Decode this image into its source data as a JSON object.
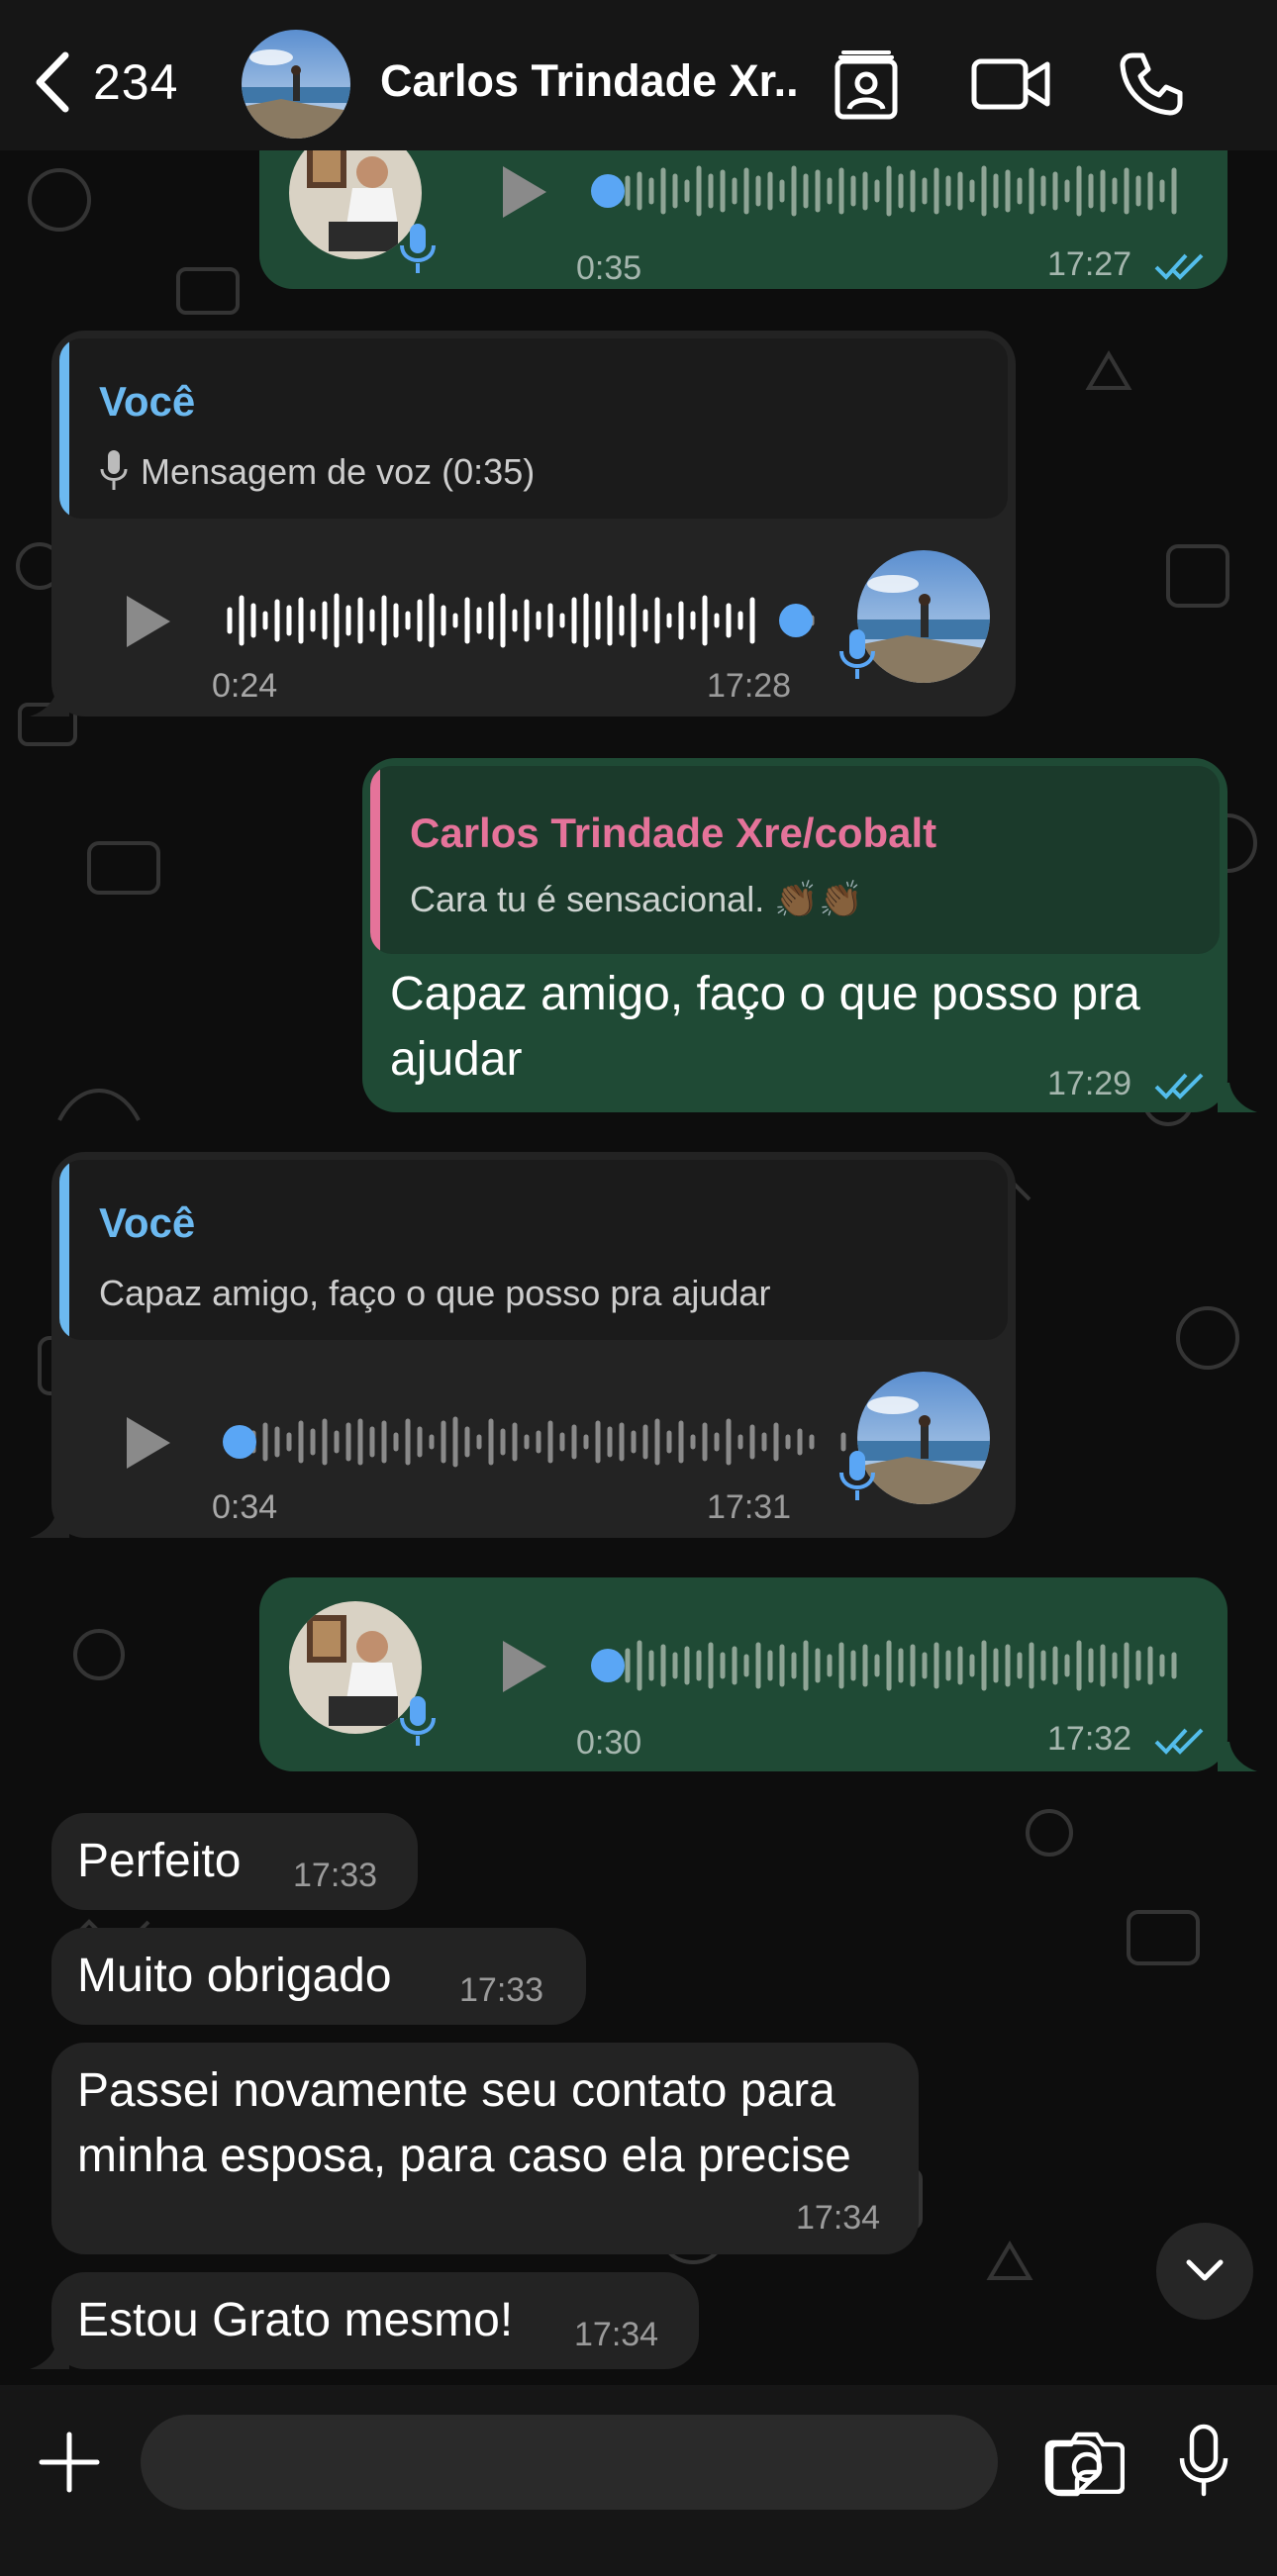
{
  "header": {
    "back_count": "234",
    "contact_name": "Carlos Trindade Xr..."
  },
  "messages": [
    {
      "id": "voice_out_1",
      "type": "voice",
      "direction": "out",
      "duration": "0:35",
      "time": "17:27",
      "status": "read"
    },
    {
      "id": "voice_in_1",
      "type": "voice",
      "direction": "in",
      "reply_to": {
        "sender": "Você",
        "text": "Mensagem de voz (0:35)"
      },
      "duration": "0:24",
      "time": "17:28",
      "progress": 0.93
    },
    {
      "id": "text_out_1",
      "type": "text",
      "direction": "out",
      "reply_to": {
        "sender": "Carlos Trindade Xre/cobalt",
        "text": "Cara tu é sensacional. 👏🏾👏🏾"
      },
      "text_line1": "Capaz amigo, faço o que posso pra",
      "text_line2": "ajudar",
      "time": "17:29",
      "status": "read"
    },
    {
      "id": "voice_in_2",
      "type": "voice",
      "direction": "in",
      "reply_to": {
        "sender": "Você",
        "text": "Capaz amigo, faço o que posso pra ajudar"
      },
      "duration": "0:34",
      "time": "17:31",
      "progress": 0.0
    },
    {
      "id": "voice_out_2",
      "type": "voice",
      "direction": "out",
      "duration": "0:30",
      "time": "17:32",
      "status": "read"
    },
    {
      "id": "text_in_1",
      "type": "text",
      "direction": "in",
      "text": "Perfeito",
      "time": "17:33"
    },
    {
      "id": "text_in_2",
      "type": "text",
      "direction": "in",
      "text": "Muito obrigado",
      "time": "17:33"
    },
    {
      "id": "text_in_3",
      "type": "text",
      "direction": "in",
      "text_line1": "Passei novamente seu contato para",
      "text_line2": "minha esposa, para caso ela precise",
      "time": "17:34"
    },
    {
      "id": "text_in_4",
      "type": "text",
      "direction": "in",
      "text": "Estou Grato mesmo!",
      "time": "17:34"
    }
  ],
  "composer": {
    "placeholder": ""
  },
  "colors": {
    "outgoing_bubble": "#1f4a35",
    "incoming_bubble": "#232323",
    "read_ticks": "#53bdeb",
    "quote_you": "#6cb9f0",
    "quote_contact": "#e5739a",
    "wave_played": "#ffffff",
    "wave_unplayed": "#8a8a8a",
    "progress_dot": "#5aa6f5"
  },
  "icons": [
    "chevron-left-icon",
    "contact-card-icon",
    "video-camera-icon",
    "phone-icon",
    "play-icon",
    "mic-icon",
    "read-ticks-icon",
    "plus-icon",
    "sticker-icon",
    "camera-icon",
    "chevron-down-icon"
  ]
}
